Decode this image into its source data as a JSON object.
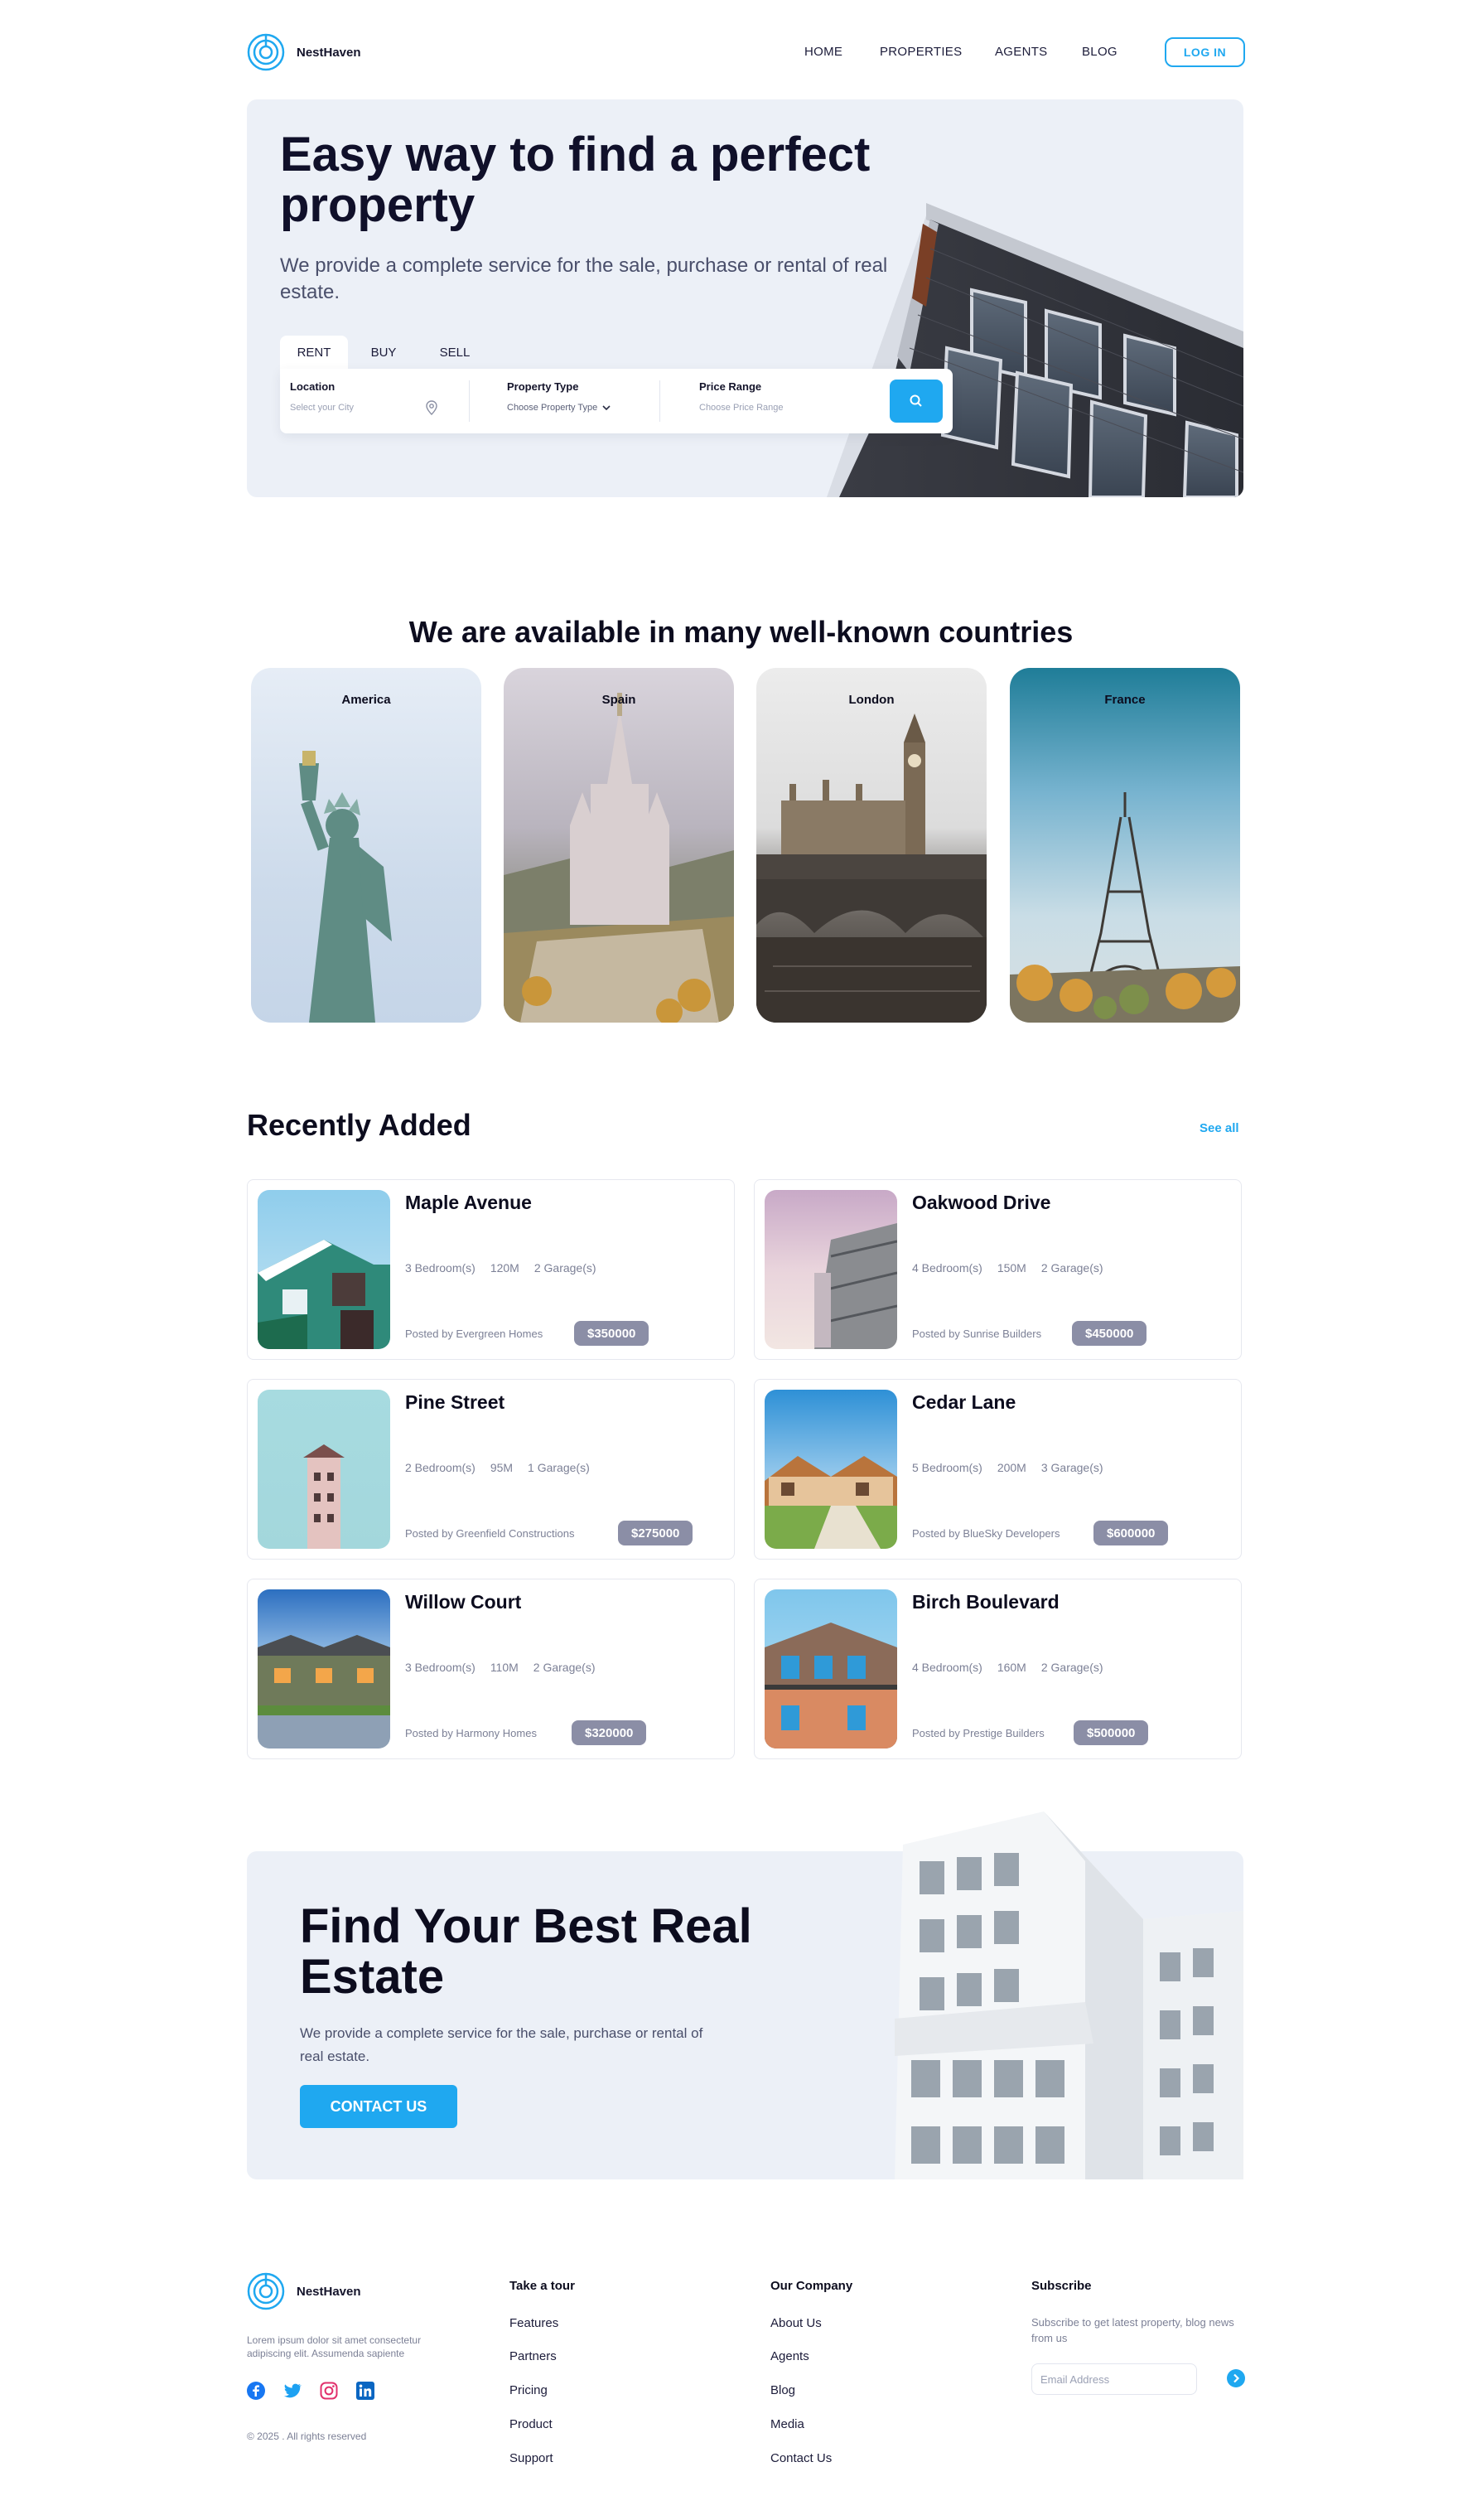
{
  "brand": {
    "name": "NestHaven"
  },
  "nav": {
    "links": [
      "HOME",
      "PROPERTIES",
      "AGENTS",
      "BLOG"
    ],
    "login": "LOG IN"
  },
  "hero": {
    "title": "Easy way to find a perfect property",
    "subtitle": "We provide a complete service for the sale, purchase or rental of real estate.",
    "tabs": [
      "RENT",
      "BUY",
      "SELL"
    ],
    "active_tab": "RENT",
    "search": {
      "location_label": "Location",
      "location_placeholder": "Select your City",
      "type_label": "Property Type",
      "type_value": "Choose Property Type",
      "price_label": "Price Range",
      "price_placeholder": "Choose Price Range"
    }
  },
  "countries": {
    "title": "We are available in many well-known countries",
    "items": [
      "America",
      "Spain",
      "London",
      "France"
    ]
  },
  "recent": {
    "title": "Recently Added",
    "see_all": "See all",
    "listings": [
      {
        "title": "Maple Avenue",
        "bedrooms": "3 Bedroom(s)",
        "size": "120M",
        "garages": "2 Garage(s)",
        "posted_by": "Posted by Evergreen Homes",
        "price": "$350000"
      },
      {
        "title": "Oakwood Drive",
        "bedrooms": "4 Bedroom(s)",
        "size": "150M",
        "garages": "2 Garage(s)",
        "posted_by": "Posted by Sunrise Builders",
        "price": "$450000"
      },
      {
        "title": "Pine Street",
        "bedrooms": "2 Bedroom(s)",
        "size": "95M",
        "garages": "1 Garage(s)",
        "posted_by": "Posted by Greenfield Constructions",
        "price": "$275000"
      },
      {
        "title": "Cedar Lane",
        "bedrooms": "5 Bedroom(s)",
        "size": "200M",
        "garages": "3 Garage(s)",
        "posted_by": "Posted by BlueSky Developers",
        "price": "$600000"
      },
      {
        "title": "Willow Court",
        "bedrooms": "3 Bedroom(s)",
        "size": "110M",
        "garages": "2 Garage(s)",
        "posted_by": "Posted by Harmony Homes",
        "price": "$320000"
      },
      {
        "title": "Birch Boulevard",
        "bedrooms": "4 Bedroom(s)",
        "size": "160M",
        "garages": "2 Garage(s)",
        "posted_by": "Posted by Prestige Builders",
        "price": "$500000"
      }
    ]
  },
  "cta": {
    "title": "Find Your Best Real Estate",
    "subtitle": "We provide a complete service for the sale, purchase or rental of real estate.",
    "button": "CONTACT US"
  },
  "footer": {
    "brand": "NestHaven",
    "about": "Lorem ipsum dolor sit amet consectetur adipiscing elit. Assumenda sapiente",
    "copyright": "© 2025 . All rights reserved",
    "social_icons": [
      "facebook-icon",
      "twitter-icon",
      "instagram-icon",
      "linkedin-icon"
    ],
    "tour": {
      "title": "Take a tour",
      "links": [
        "Features",
        "Partners",
        "Pricing",
        "Product",
        "Support"
      ]
    },
    "company": {
      "title": "Our Company",
      "links": [
        "About Us",
        "Agents",
        "Blog",
        "Media",
        "Contact Us"
      ]
    },
    "subscribe": {
      "title": "Subscribe",
      "text": "Subscribe to get latest property, blog news from us",
      "placeholder": "Email Address"
    }
  },
  "colors": {
    "accent": "#1fa8f0",
    "hero_bg": "#ecf0f7",
    "price_pill": "#8b8ea6",
    "heading": "#10102a"
  }
}
